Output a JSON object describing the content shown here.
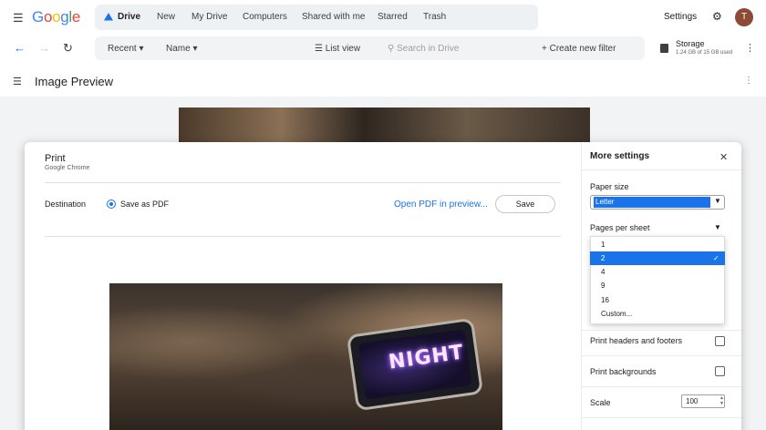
{
  "app": {
    "logo_letters": [
      {
        "ch": "G",
        "color": "#4285F4"
      },
      {
        "ch": "o",
        "color": "#EA4335"
      },
      {
        "ch": "o",
        "color": "#FBBC05"
      },
      {
        "ch": "g",
        "color": "#4285F4"
      },
      {
        "ch": "l",
        "color": "#34A853"
      },
      {
        "ch": "e",
        "color": "#EA4335"
      }
    ]
  },
  "topnav": {
    "items": [
      "Drive",
      "New",
      "My Drive",
      "Computers",
      "Shared with me",
      "Starred",
      "Trash"
    ],
    "settings_label": "Settings",
    "avatar_initial": "T"
  },
  "toolbar": {
    "recent_label": "Recent",
    "name_label": "Name",
    "list_view_label": "List view",
    "search_placeholder": "Search in Drive",
    "filter_label": "Create new filter",
    "storage_title": "Storage",
    "storage_usage": "1.24 GB of 15 GB used"
  },
  "preview": {
    "title": "Image Preview"
  },
  "print_dialog": {
    "title": "Print",
    "subtitle": "Google Chrome",
    "destination_label": "Destination",
    "destination_value": "Save as PDF",
    "open_pdf_link": "Open PDF in preview...",
    "save_button": "Save",
    "photo_text": "NIGHT"
  },
  "more_settings": {
    "title": "More settings",
    "paper_size_label": "Paper size",
    "paper_size_value": "Letter",
    "pages_per_sheet_label": "Pages per sheet",
    "pages_per_sheet_options": [
      "1",
      "2",
      "4",
      "9",
      "16",
      "Custom..."
    ],
    "pages_per_sheet_selected": "2",
    "headers_footers_label": "Print headers and footers",
    "backgrounds_label": "Print backgrounds",
    "scale_label": "Scale",
    "scale_value": "100"
  },
  "colors": {
    "accent": "#1a73e8",
    "dropdown_selected_bg": "#1a73e8"
  }
}
